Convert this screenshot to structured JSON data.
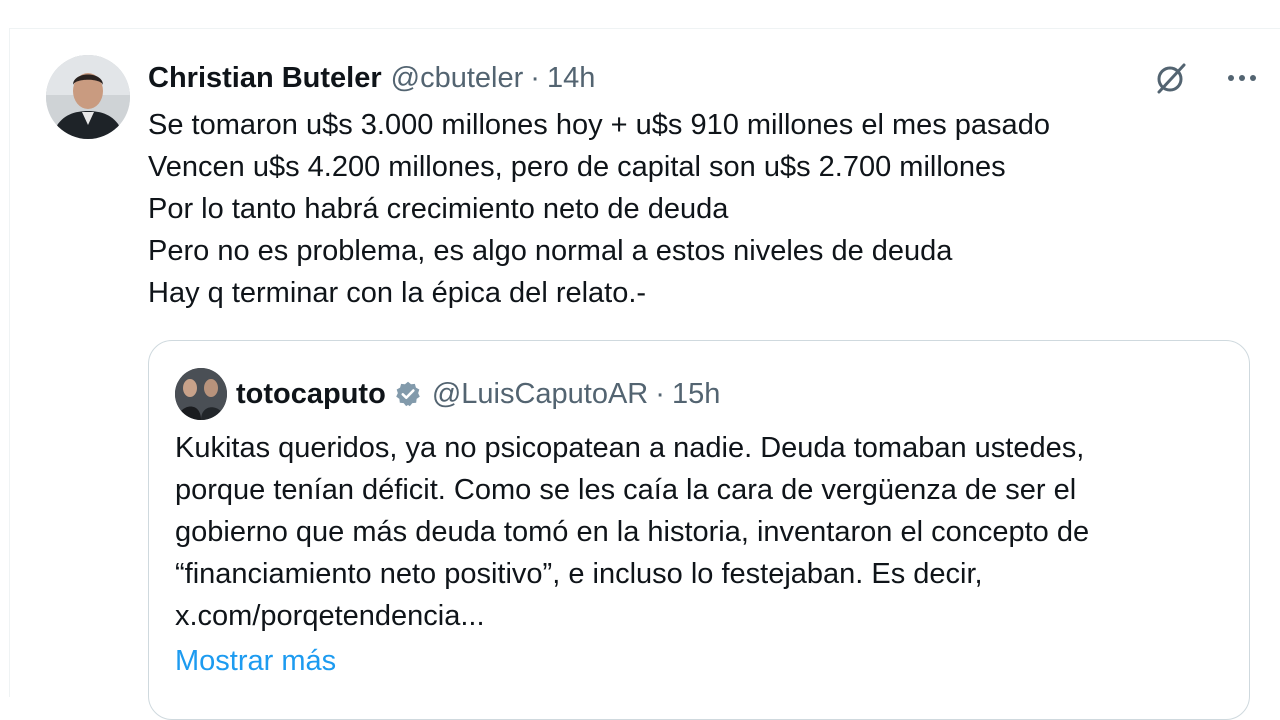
{
  "tweet": {
    "author_name": "Christian Buteler",
    "author_handle": "@cbuteler",
    "separator": "·",
    "time": "14h",
    "lines": [
      "Se tomaron u$s 3.000 millones hoy + u$s 910 millones el mes pasado",
      "Vencen u$s 4.200 millones, pero de capital son u$s 2.700 millones",
      "Por lo tanto habrá crecimiento neto de deuda",
      "Pero no es problema, es algo normal a estos niveles de deuda",
      "Hay q terminar con la épica del relato.-"
    ],
    "icons": {
      "grok": "grok-icon",
      "more": "more-icon"
    }
  },
  "quote": {
    "author_name": "totocaputo",
    "author_handle": "@LuisCaputoAR",
    "separator": "·",
    "time": "15h",
    "verified_icon": "verified-badge-icon",
    "lines": [
      "Kukitas queridos, ya no psicopatean a nadie. Deuda tomaban ustedes,",
      "porque tenían déficit. Como se les caía la cara de vergüenza de ser el",
      "gobierno que más deuda tomó en la historia, inventaron el concepto de",
      "“financiamiento neto positivo”, e incluso lo festejaban. Es decir,",
      "x.com/porqetendencia..."
    ],
    "show_more": "Mostrar más"
  },
  "colors": {
    "text": "#0f1419",
    "secondary": "#536471",
    "link": "#1d9bf0",
    "border": "#cfd9de",
    "verified": "#829aab"
  }
}
